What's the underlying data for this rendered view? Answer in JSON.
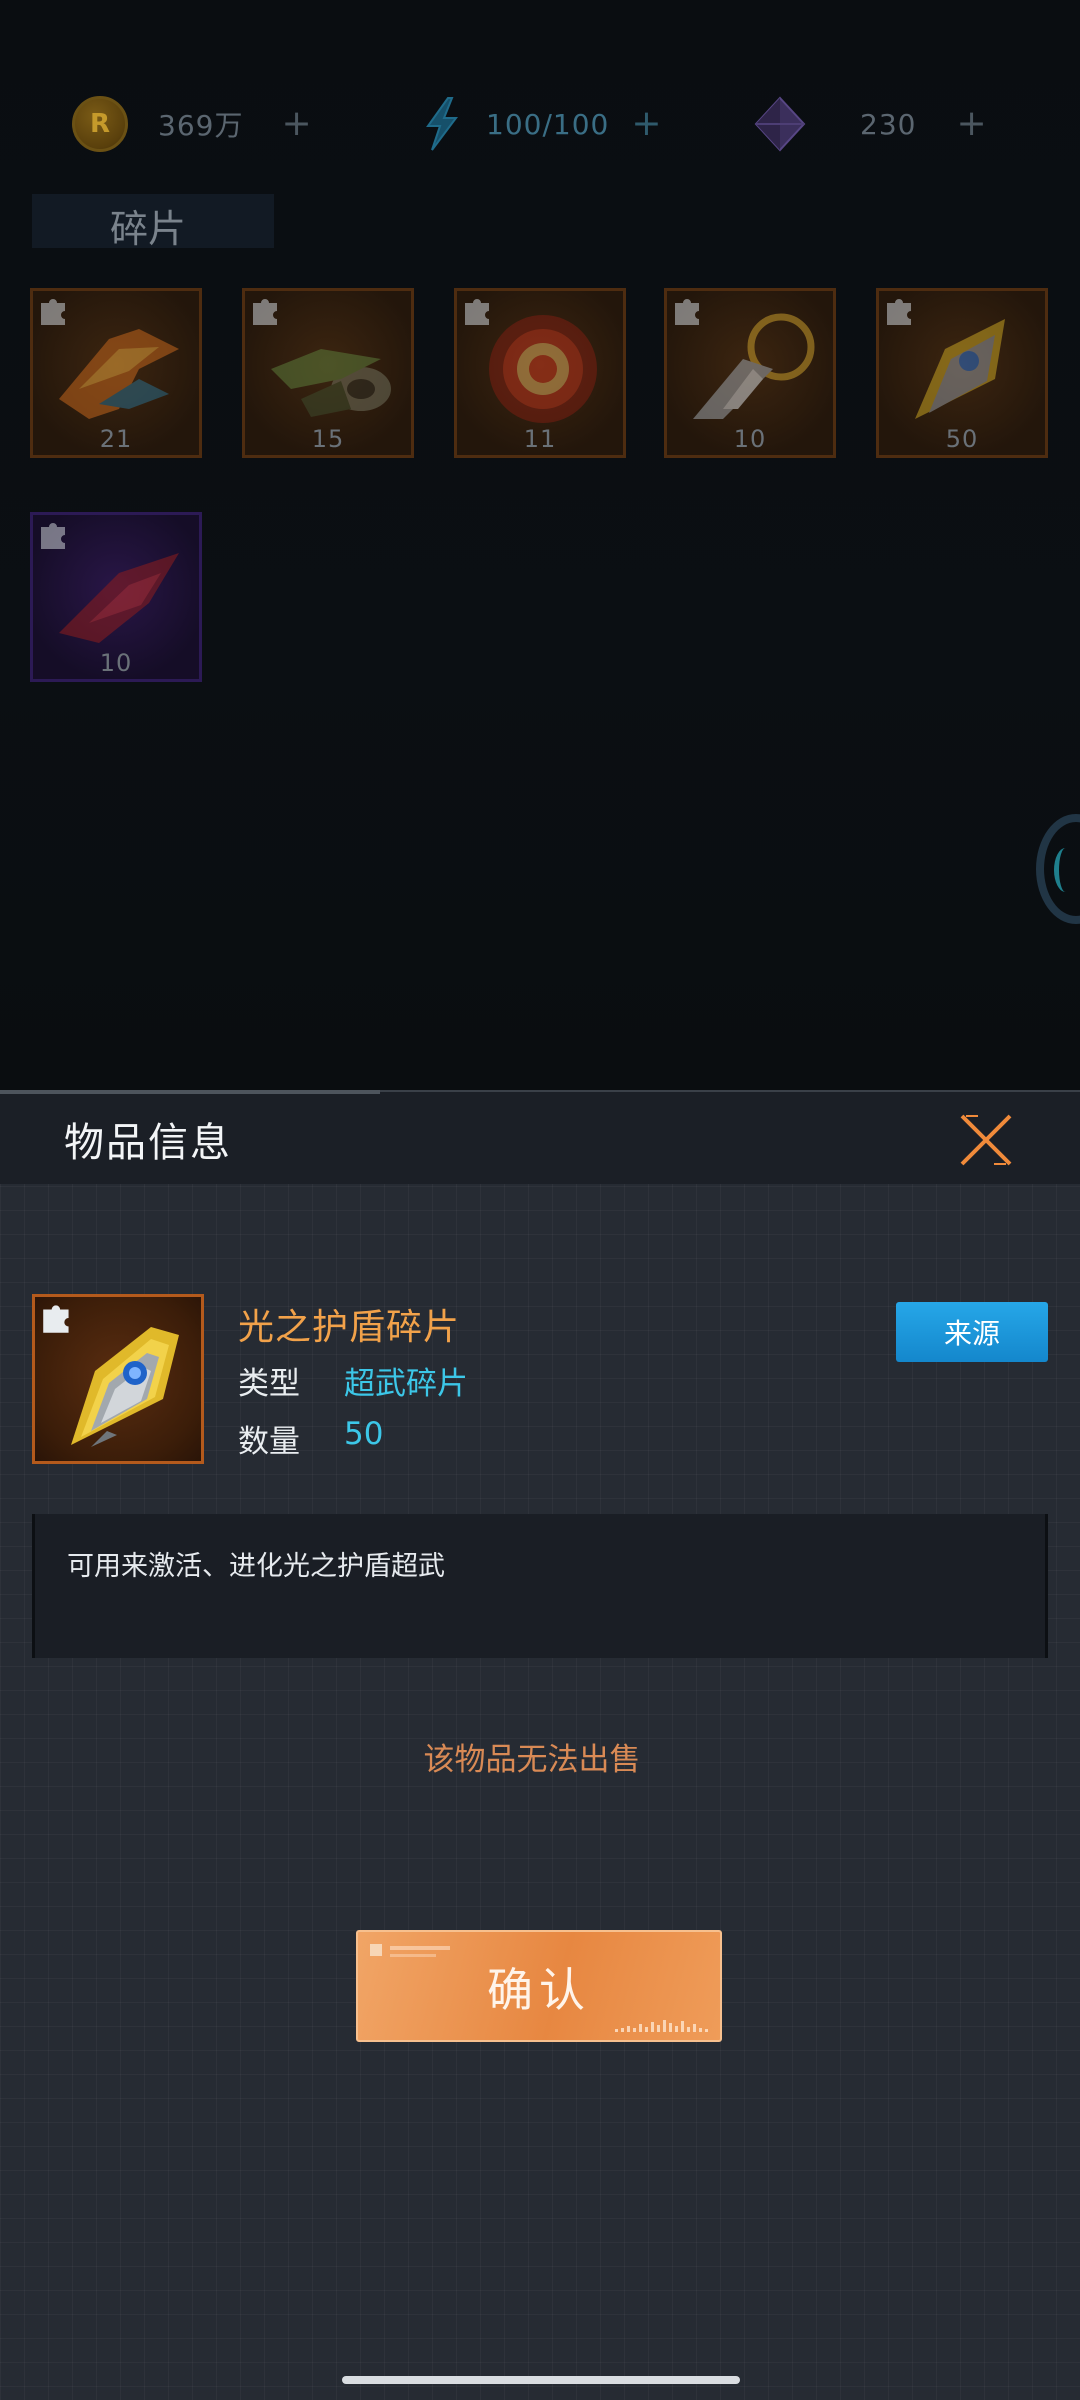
{
  "resources": [
    {
      "icon": "gold-coin-icon",
      "value": "369万",
      "plus": "+"
    },
    {
      "icon": "lightning-energy-icon",
      "value": "100/100",
      "plus": "+"
    },
    {
      "icon": "purple-crystal-icon",
      "value": "230",
      "plus": "+"
    }
  ],
  "coin_letter": "R",
  "section": {
    "title": "碎片"
  },
  "fragments": [
    {
      "count": "21",
      "art": "orange-jet-art"
    },
    {
      "count": "15",
      "art": "green-gunship-art"
    },
    {
      "count": "11",
      "art": "red-shield-art"
    },
    {
      "count": "10",
      "art": "silver-spike-ring-art"
    },
    {
      "count": "50",
      "art": "golden-shield-art"
    },
    {
      "count": "10",
      "art": "red-fighter-art"
    }
  ],
  "dialog": {
    "title": "物品信息",
    "item": {
      "name": "光之护盾碎片",
      "type_label": "类型",
      "type_value": "超武碎片",
      "qty_label": "数量",
      "qty_value": "50",
      "icon": "golden-shield-art"
    },
    "source_button": "来源",
    "description": "可用来激活、进化光之护盾超武",
    "notice": "该物品无法出售",
    "confirm_button": "确认"
  },
  "colors": {
    "accent_orange": "#f2a24a",
    "accent_cyan": "#3cc7e8",
    "source_blue": "#1f9bdf",
    "confirm_orange": "#e78741",
    "notice_orange": "#d98a55"
  }
}
